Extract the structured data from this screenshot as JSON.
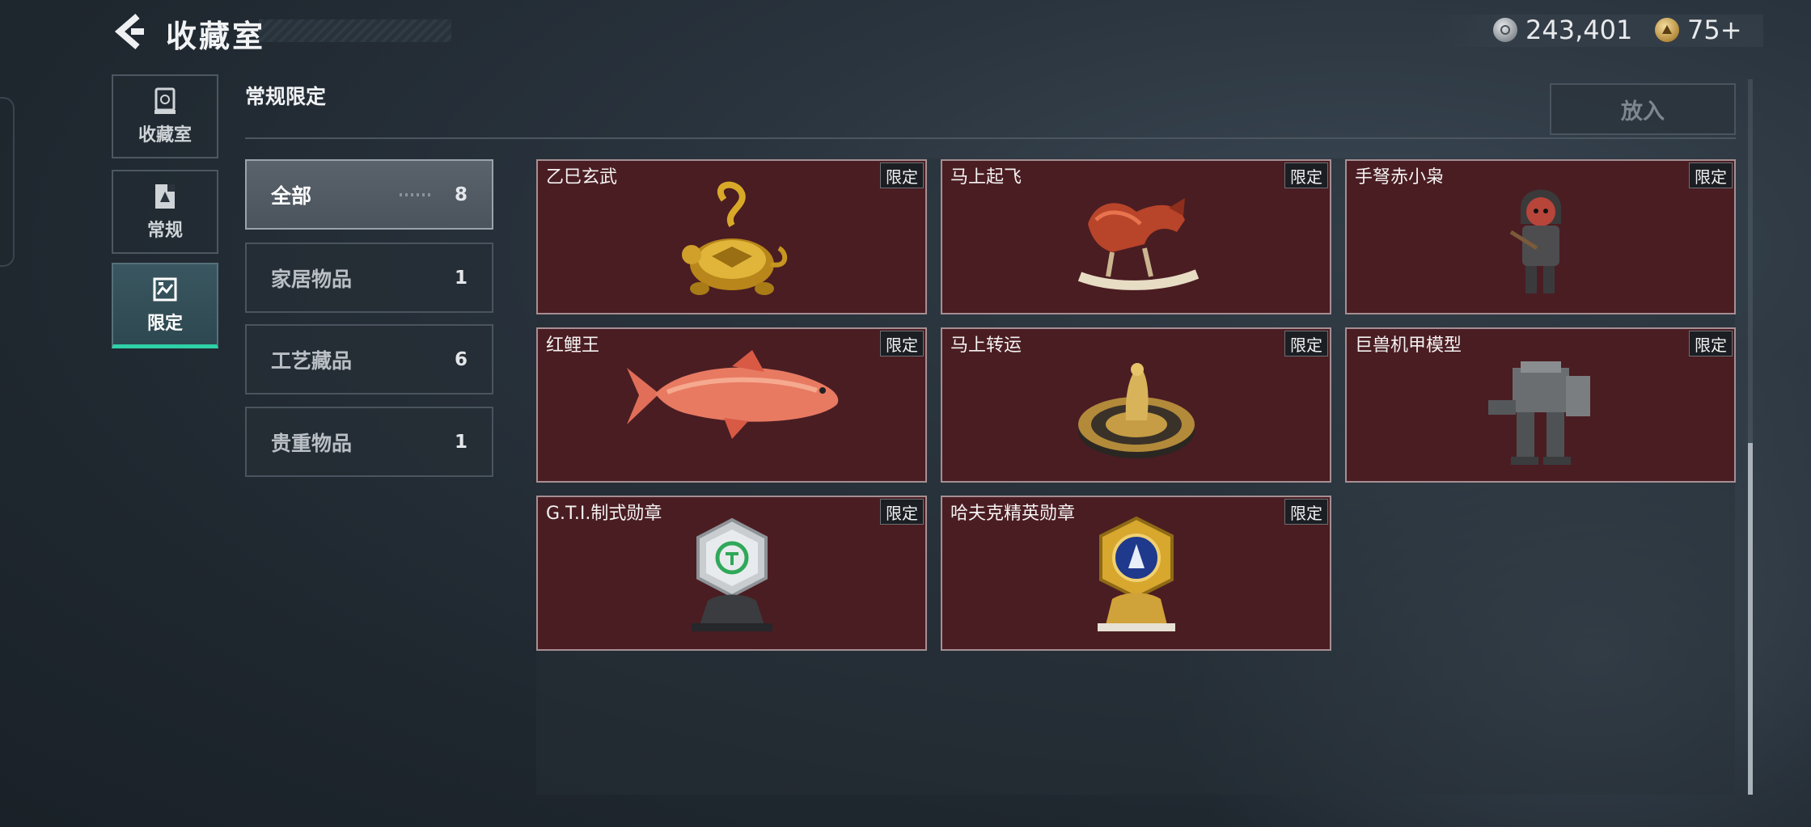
{
  "header": {
    "title": "收藏室",
    "currency": [
      {
        "icon": "silver-coin-icon",
        "value": "243,401"
      },
      {
        "icon": "gold-coin-icon",
        "value": "75+"
      }
    ]
  },
  "nav": [
    {
      "label": "收藏室",
      "icon": "trophy-icon"
    },
    {
      "label": "常规",
      "icon": "card-icon"
    },
    {
      "label": "限定",
      "icon": "limited-icon",
      "active": true
    }
  ],
  "section": {
    "title": "常规限定",
    "put_label": "放入"
  },
  "categories": [
    {
      "label": "全部",
      "count": "8",
      "active": true
    },
    {
      "label": "家居物品",
      "count": "1"
    },
    {
      "label": "工艺藏品",
      "count": "6"
    },
    {
      "label": "贵重物品",
      "count": "1"
    }
  ],
  "items": [
    {
      "name": "乙巳玄武",
      "badge": "限定",
      "icon": "golden-turtle-icon"
    },
    {
      "name": "马上起飞",
      "badge": "限定",
      "icon": "rocking-horse-icon"
    },
    {
      "name": "手弩赤小枭",
      "badge": "限定",
      "icon": "crossbow-figure-icon"
    },
    {
      "name": "红鲤王",
      "badge": "限定",
      "icon": "red-carp-icon"
    },
    {
      "name": "马上转运",
      "badge": "限定",
      "icon": "spinning-top-icon"
    },
    {
      "name": "巨兽机甲模型",
      "badge": "限定",
      "icon": "mech-model-icon"
    },
    {
      "name": "G.T.I.制式勋章",
      "badge": "限定",
      "icon": "gti-medal-icon"
    },
    {
      "name": "哈夫克精英勋章",
      "badge": "限定",
      "icon": "elite-medal-icon"
    }
  ],
  "colors": {
    "card_bg": "#4a1d22",
    "active_tab_accent": "#2fd0a8"
  }
}
